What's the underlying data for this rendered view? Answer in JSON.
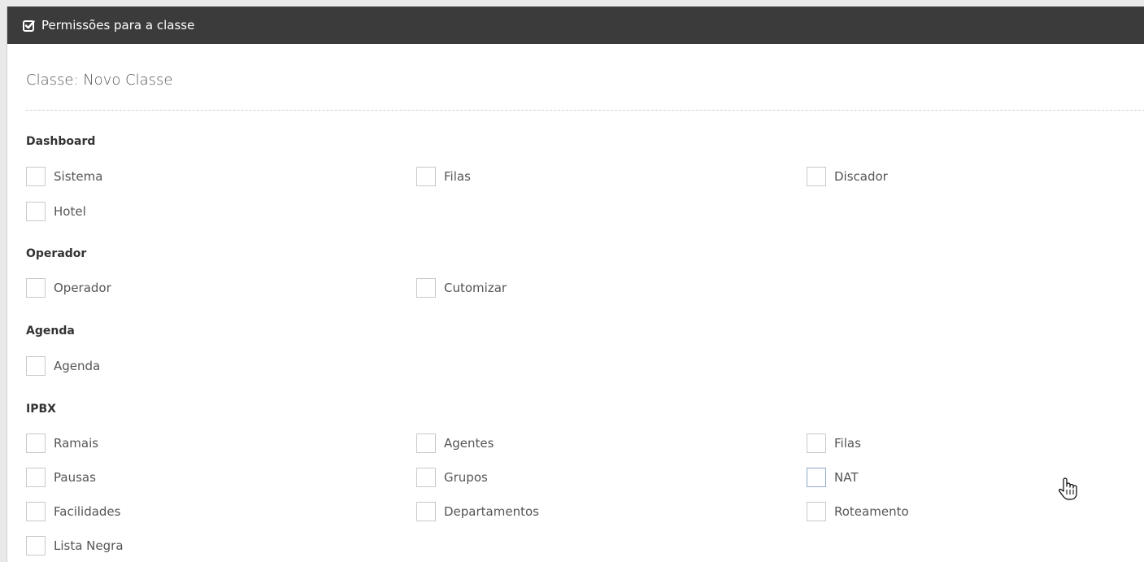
{
  "panel": {
    "title": "Permissões para a classe",
    "header_icon": "checkbox-edit-icon"
  },
  "class_title": "Classe: Novo Classe",
  "sections": [
    {
      "title": "Dashboard",
      "items": [
        "Sistema",
        "Filas",
        "Discador",
        "Hotel"
      ]
    },
    {
      "title": "Operador",
      "items": [
        "Operador",
        "Cutomizar"
      ]
    },
    {
      "title": "Agenda",
      "items": [
        "Agenda"
      ]
    },
    {
      "title": "IPBX",
      "items": [
        "Ramais",
        "Agentes",
        "Filas",
        "Pausas",
        "Grupos",
        "NAT",
        "Facilidades",
        "Departamentos",
        "Roteamento",
        "Lista Negra"
      ]
    }
  ],
  "focused_item": "NAT",
  "cursor_icon": "hand-pointer-icon"
}
